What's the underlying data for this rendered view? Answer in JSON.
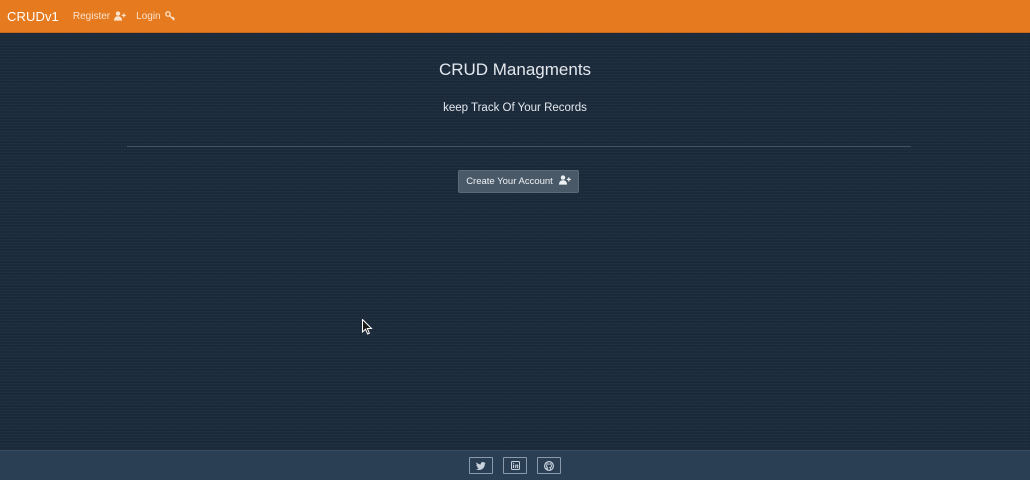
{
  "navbar": {
    "brand": "CRUDv1",
    "links": [
      {
        "label": "Register",
        "icon": "user-plus-icon"
      },
      {
        "label": "Login",
        "icon": "key-icon"
      }
    ],
    "background": "#e57a1f"
  },
  "hero": {
    "title": "CRUD Managments",
    "subtitle": "keep Track Of Your Records",
    "cta_label": "Create Your Account",
    "cta_icon": "user-plus-icon"
  },
  "footer": {
    "social": [
      {
        "name": "twitter",
        "icon": "twitter-icon"
      },
      {
        "name": "linkedin",
        "icon": "linkedin-icon"
      },
      {
        "name": "github",
        "icon": "github-icon"
      }
    ]
  },
  "colors": {
    "page_background": "#1c2b3b",
    "footer_background": "#2a3e54",
    "button_background": "#4a5968"
  }
}
